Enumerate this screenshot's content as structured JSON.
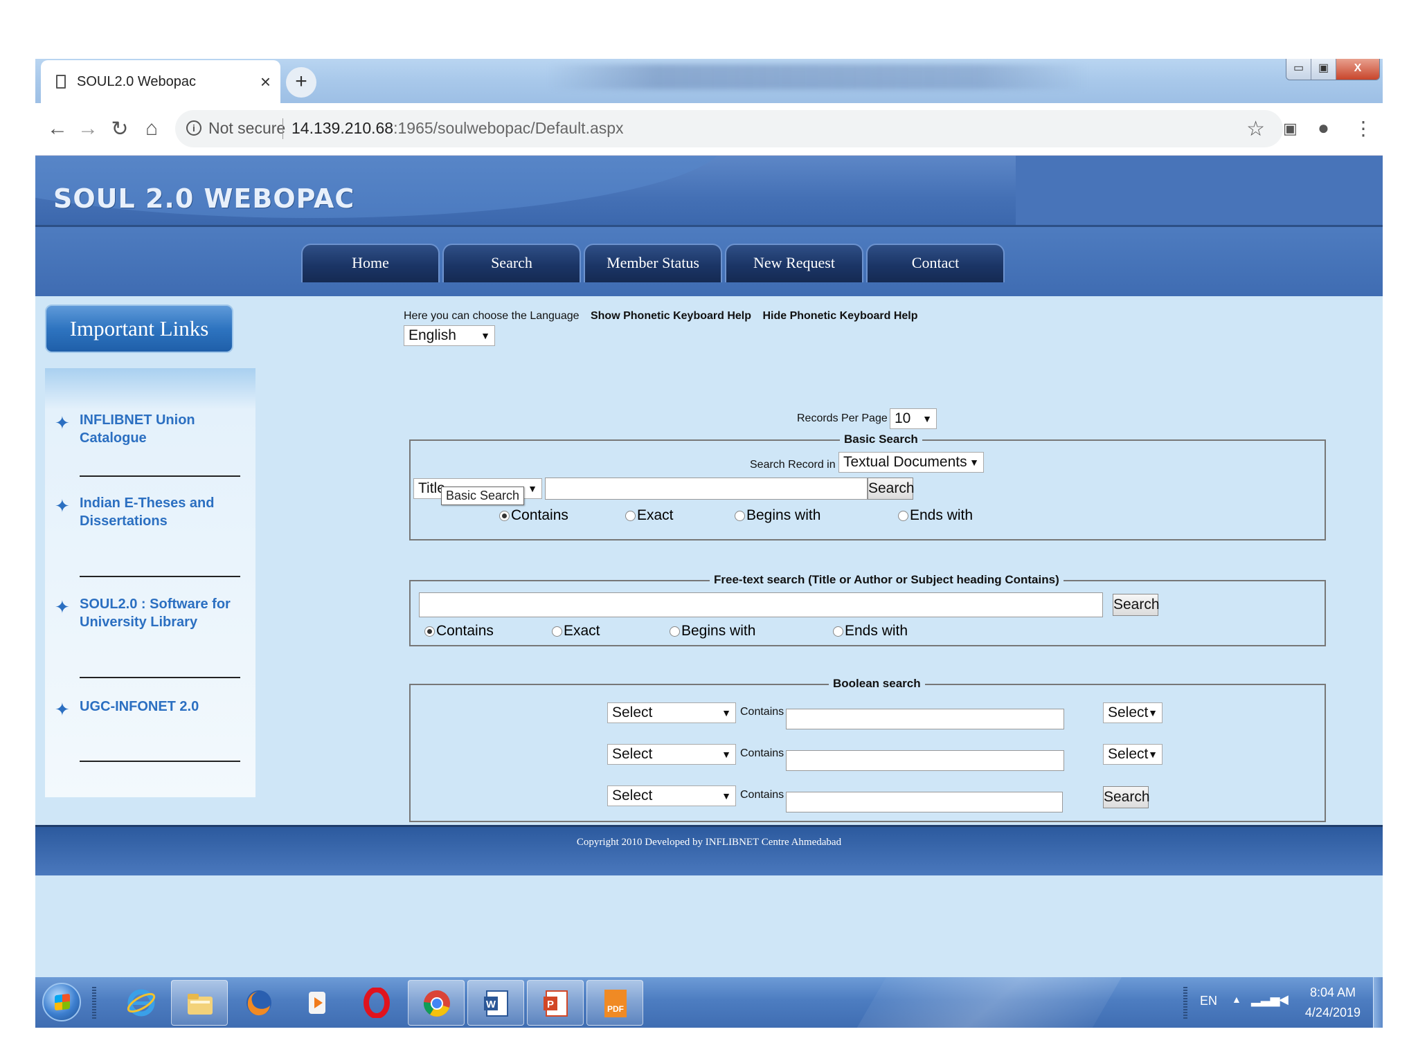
{
  "browser": {
    "tab_title": "SOUL2.0 Webopac",
    "tab_close": "×",
    "new_tab": "+",
    "not_secure": "Not secure",
    "url_host": "14.139.210.68",
    "url_path": ":1965/soulwebopac/Default.aspx",
    "window_controls": {
      "minimize": "▭",
      "restore": "▣",
      "close": "X"
    }
  },
  "site": {
    "logo": "SOUL 2.0 WEBOPAC",
    "menu": [
      "Home",
      "Search",
      "Member Status",
      "New Request",
      "Contact"
    ]
  },
  "sidebar": {
    "header": "Important Links",
    "links": [
      "INFLIBNET Union Catalogue",
      "Indian E-Theses and Dissertations",
      "SOUL2.0 : Software for University Library",
      "UGC-INFONET 2.0"
    ]
  },
  "language": {
    "prompt": "Here you can choose the Language",
    "show_help": "Show Phonetic Keyboard Help",
    "hide_help": "Hide Phonetic Keyboard Help",
    "selected": "English"
  },
  "records": {
    "label": "Records Per Page",
    "selected": "10"
  },
  "basic_search": {
    "legend": "Basic Search",
    "search_in_label": "Search Record in",
    "search_in_selected": "Textual Documents",
    "field_selected": "Title",
    "tooltip": "Basic Search",
    "query": "",
    "button": "Search",
    "options": [
      "Contains",
      "Exact",
      "Begins with",
      "Ends with"
    ],
    "selected_option": "Contains"
  },
  "free_text": {
    "legend": "Free-text search (Title or Author or Subject heading Contains)",
    "query": "",
    "button": "Search",
    "options": [
      "Contains",
      "Exact",
      "Begins with",
      "Ends with"
    ],
    "selected_option": "Contains"
  },
  "boolean_search": {
    "legend": "Boolean search",
    "rows": [
      {
        "field": "Select",
        "op_label": "Contains",
        "value": "",
        "connector": "Select"
      },
      {
        "field": "Select",
        "op_label": "Contains",
        "value": "",
        "connector": "Select"
      },
      {
        "field": "Select",
        "op_label": "Contains",
        "value": "",
        "connector": ""
      }
    ],
    "button": "Search"
  },
  "footer": {
    "copyright": "Copyright  2010 Developed by INFLIBNET Centre Ahmedabad"
  },
  "taskbar": {
    "language": "EN",
    "time": "8:04 AM",
    "date": "4/24/2019",
    "apps": [
      "internet-explorer",
      "file-explorer",
      "firefox",
      "media-player",
      "opera",
      "chrome",
      "word",
      "powerpoint",
      "pdf-reader"
    ]
  },
  "colors": {
    "header_blue": "#4470b5",
    "menu_dark": "#1b3566",
    "content_bg": "#cfe6f7",
    "link_blue": "#2b6fc1"
  }
}
